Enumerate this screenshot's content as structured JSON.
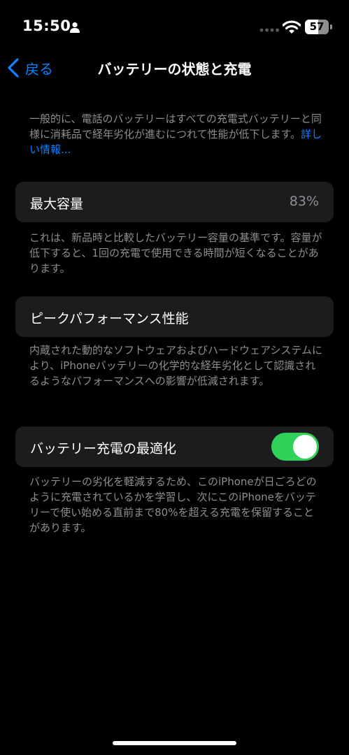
{
  "status_bar": {
    "time": "15:50",
    "battery_level": "57",
    "battery_fraction": 0.57,
    "icons": [
      "person-icon",
      "cellular-signal-icon",
      "wifi-icon",
      "battery-icon"
    ]
  },
  "nav": {
    "back_label": "戻る",
    "title": "バッテリーの状態と充電"
  },
  "intro": {
    "text": "一般的に、電話のバッテリーはすべての充電式バッテリーと同様に消耗品で経年劣化が進むにつれて性能が低下します。",
    "link": "詳しい情報..."
  },
  "max_capacity": {
    "label": "最大容量",
    "value": "83%",
    "description": "これは、新品時と比較したバッテリー容量の基準です。容量が低下すると、1回の充電で使用できる時間が短くなることがあります。"
  },
  "peak_performance": {
    "label": "ピークパフォーマンス性能",
    "description": "内蔵された動的なソフトウェアおよびハードウェアシステムにより、iPhoneバッテリーの化学的な経年劣化として認識されるようなパフォーマンスへの影響が低減されます。"
  },
  "optimized_charging": {
    "label": "バッテリー充電の最適化",
    "enabled": true,
    "description": "バッテリーの劣化を軽減するため、このiPhoneが日ごろどのように充電されているかを学習し、次にこのiPhoneをバッテリーで使い始める直前まで80%を超える充電を保留することがあります。"
  },
  "colors": {
    "background": "#000000",
    "cell": "#1c1c1e",
    "accent": "#0a84ff",
    "toggle_on": "#30d158",
    "secondary_text": "#8e8e93"
  }
}
